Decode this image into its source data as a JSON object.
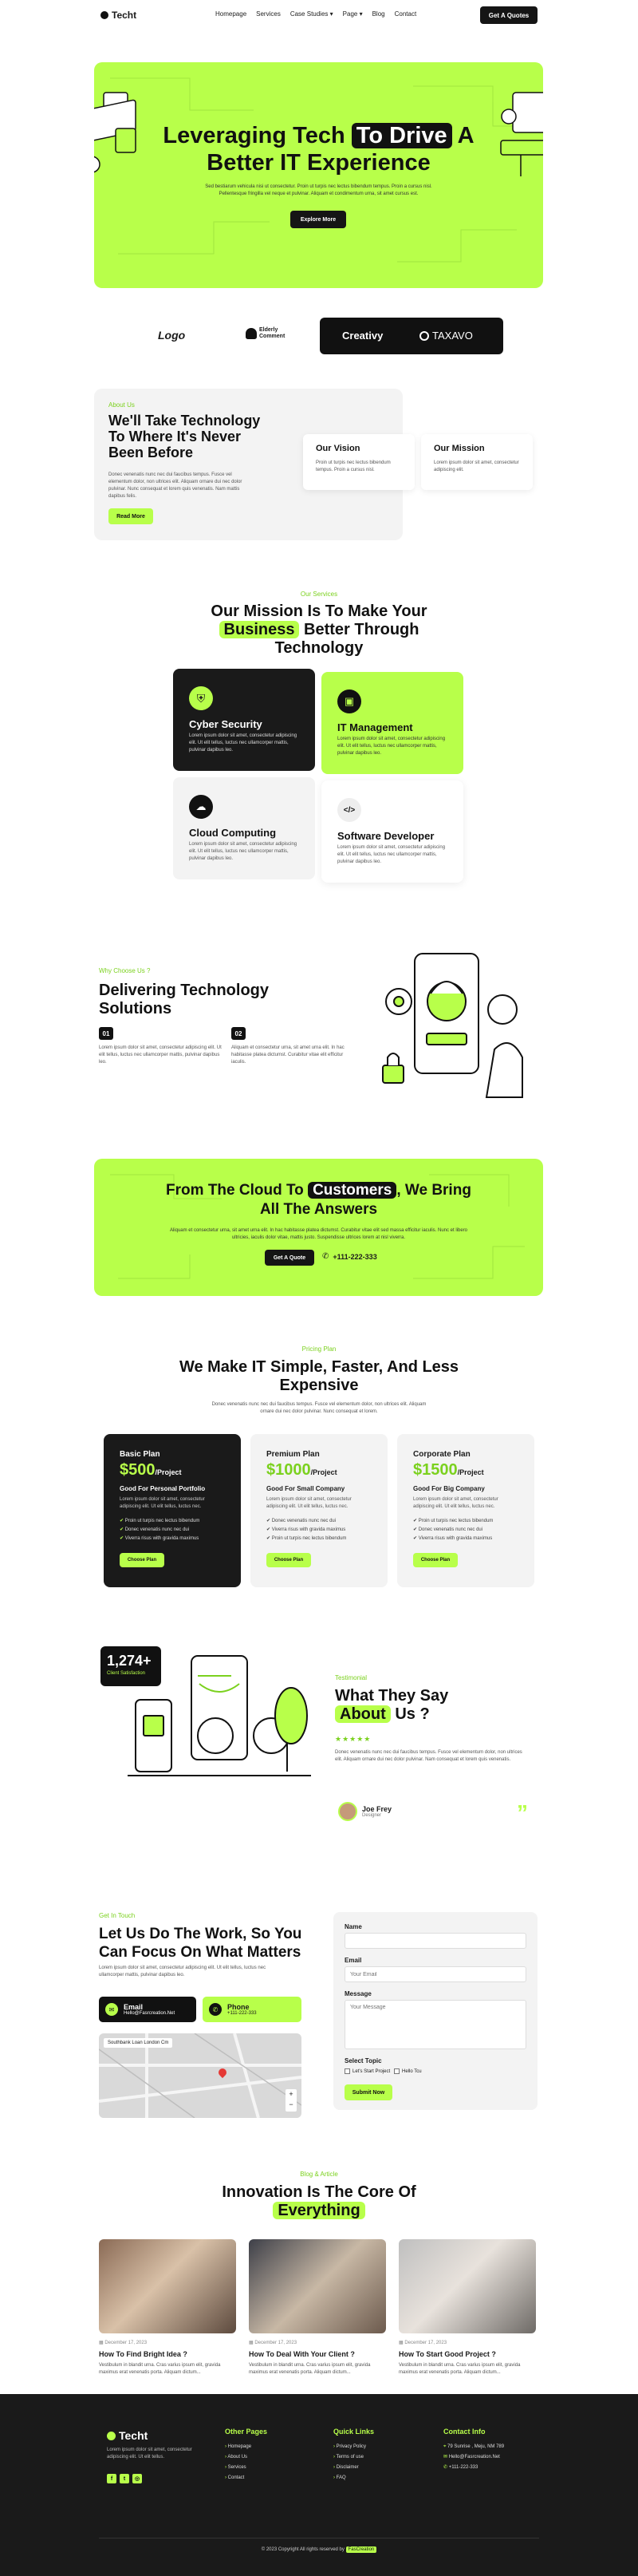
{
  "nav": {
    "logo": "Techt",
    "links": [
      "Homepage",
      "Services",
      "Case Studies ▾",
      "Page ▾",
      "Blog",
      "Contact"
    ],
    "cta": "Get A Quotes"
  },
  "hero": {
    "title_before": "Leveraging Tech",
    "title_highlight": "To Drive",
    "title_after": "A",
    "title_line2": "Better IT Experience",
    "text": "Sed bestiarum vehicula nisi ut consectetur. Proin ut turpis nec lectus bibendum tempus. Proin a cursus nisl. Pellentesque fringilla vel neque et pulvinar. Aliquam et condimentum urna, sit amet cursus est.",
    "button": "Explore More"
  },
  "logos": {
    "logo1": "Logo",
    "logo2_line1": "Elderly",
    "logo2_line2": "Comment",
    "logo3": "Creativy",
    "logo4": "TAXAVO"
  },
  "about": {
    "eyebrow": "About Us",
    "title_line1": "We'll Take Technology",
    "title_line2": "To Where It's Never",
    "title_line3": "Been Before",
    "text": "Donec venenatis nunc nec dui faucibus tempus. Fusce vel elementum dolor, non ultrices elit. Aliquam ornare dui nec dolor pulvinar. Nunc consequat et lorem quis venenatis. Nam mattis dapibus felis.",
    "button": "Read More",
    "vision_title": "Our Vision",
    "vision_text": "Proin ut turpis nec lectus bibendum tempus. Proin a cursus nisl.",
    "mission_title": "Our Mission",
    "mission_text": "Lorem ipsum dolor sit amet, consectetur adipiscing elit."
  },
  "services": {
    "eyebrow": "Our Services",
    "title_line1": "Our Mission Is To Make Your",
    "title_highlight": "Business",
    "title_line2_after": "Better Through",
    "title_line3": "Technology",
    "cards": [
      {
        "title": "Cyber Security",
        "text": "Lorem ipsum dolor sit amet, consectetur adipiscing elit. Ut elit tellus, luctus nec ullamcorper mattis, pulvinar dapibus leo."
      },
      {
        "title": "IT Management",
        "text": "Lorem ipsum dolor sit amet, consectetur adipiscing elit. Ut elit tellus, luctus nec ullamcorper mattis, pulvinar dapibus leo."
      },
      {
        "title": "Cloud Computing",
        "text": "Lorem ipsum dolor sit amet, consectetur adipiscing elit. Ut elit tellus, luctus nec ullamcorper mattis, pulvinar dapibus leo."
      },
      {
        "title": "Software Developer",
        "text": "Lorem ipsum dolor sit amet, consectetur adipiscing elit. Ut elit tellus, luctus nec ullamcorper mattis, pulvinar dapibus leo."
      }
    ]
  },
  "why": {
    "eyebrow": "Why Choose Us ?",
    "title_line1": "Delivering Technology",
    "title_line2": "Solutions",
    "item1_num": "01",
    "item1_text": "Lorem ipsum dolor sit amet, consectetur adipiscing elit. Ut elit tellus, luctus nec ullamcorper mattis, pulvinar dapibus leo.",
    "item2_num": "02",
    "item2_text": "Aliquam et consectetur urna, sit amet urna elit. In hac habitasse platea dictumst. Curabitur vitae elit efficitur iaculis."
  },
  "cta": {
    "title_before": "From The Cloud To",
    "title_highlight": "Customers",
    "title_after": ", We Bring",
    "title_line2": "All The Answers",
    "text": "Aliquam et consectetur urna, sit amet urna elit. In hac habitasse platea dictumst. Curabitur vitae elit sed massa efficitur iaculis. Nunc et libero ultricies, iaculis dolor vitae, mattis justo. Suspendisse ultrices lorem at nisl viverra.",
    "button": "Get A Quote",
    "phone": "+111-222-333"
  },
  "pricing": {
    "eyebrow": "Pricing Plan",
    "title_line1": "We Make IT Simple, Faster, And Less",
    "title_line2": "Expensive",
    "text": "Donec venenatis nunc nec dui faucibus tempus. Fusce vel elementum dolor, non ultrices elit. Aliquam ornare dui nec dolor pulvinar. Nunc consequat et lorem.",
    "plans": [
      {
        "name": "Basic Plan",
        "price": "$500",
        "unit": "/Project",
        "subtitle": "Good For Personal Portfolio",
        "text": "Lorem ipsum dolor sit amet, consectetur adipiscing elit. Ut elit tellus, luctus nec.",
        "features": [
          "Proin ut turpis nec lectus bibendum",
          "Donec venenatis nunc nec dui",
          "Viverra risus with gravida maximus"
        ],
        "button": "Choose Plan"
      },
      {
        "name": "Premium Plan",
        "price": "$1000",
        "unit": "/Project",
        "subtitle": "Good For Small Company",
        "text": "Lorem ipsum dolor sit amet, consectetur adipiscing elit. Ut elit tellus, luctus nec.",
        "features": [
          "Donec venenatis nunc nec dui",
          "Viverra risus with gravida maximus",
          "Proin ut turpis nec lectus bibendum"
        ],
        "button": "Choose Plan"
      },
      {
        "name": "Corporate Plan",
        "price": "$1500",
        "unit": "/Project",
        "subtitle": "Good For Big Company",
        "text": "Lorem ipsum dolor sit amet, consectetur adipiscing elit. Ut elit tellus, luctus nec.",
        "features": [
          "Proin ut turpis nec lectus bibendum",
          "Donec venenatis nunc nec dui",
          "Viverra risus with gravida maximus"
        ],
        "button": "Choose Plan"
      }
    ]
  },
  "testimonial": {
    "stat": "1,274+",
    "stat_label": "Client Satisfaction",
    "eyebrow": "Testimonial",
    "title_line1": "What They Say",
    "title_highlight": "About",
    "title_after": "Us ?",
    "stars": "★★★★★",
    "quote": "Donec venenatis nunc nec dui faucibus tempus. Fusce vel elementum dolor, non ultrices elit. Aliquam ornare dui nec dolor pulvinar. Nam consequat et lorem quis venenatis.",
    "name": "Joe Frey",
    "role": "Designer"
  },
  "contact": {
    "eyebrow": "Get In Touch",
    "title_line1": "Let Us Do The Work, So You",
    "title_line2": "Can Focus On What Matters",
    "text": "Lorem ipsum dolor sit amet, consectetur adipiscing elit. Ut elit tellus, luctus nec ullamcorper mattis, pulvinar dapibus leo.",
    "email_label": "Email",
    "email_value": "Hello@Fasrcreation.Net",
    "phone_label": "Phone",
    "phone_value": "+111-222-333",
    "map_label": "Southbank Loan London Cm",
    "form": {
      "name_label": "Name",
      "name_placeholder": "",
      "email_label": "Email",
      "email_placeholder": "Your Email",
      "message_label": "Message",
      "message_placeholder": "Your Message",
      "topic_label": "Select Topic",
      "topic1": "Let's Start Project",
      "topic2": "Hello Tcu",
      "submit": "Submit Now"
    }
  },
  "blog": {
    "eyebrow": "Blog & Article",
    "title_line1": "Innovation Is The Core Of",
    "title_highlight": "Everything",
    "posts": [
      {
        "date": "December 17, 2023",
        "title": "How To Find Bright Idea ?",
        "text": "Vestibulum in blandit urna. Cras varius ipsum elit, gravida maximus erat venenatis porta. Aliquam dictum..."
      },
      {
        "date": "December 17, 2023",
        "title": "How To Deal With Your Client ?",
        "text": "Vestibulum in blandit urna. Cras varius ipsum elit, gravida maximus erat venenatis porta. Aliquam dictum..."
      },
      {
        "date": "December 17, 2023",
        "title": "How To Start Good Project ?",
        "text": "Vestibulum in blandit urna. Cras varius ipsum elit, gravida maximus erat venenatis porta. Aliquam dictum..."
      }
    ]
  },
  "footer": {
    "logo": "Techt",
    "text": "Lorem ipsum dolor sit amet, consectetur adipiscing elit. Ut elit tellus.",
    "col1_title": "Other Pages",
    "col1": [
      "Homepage",
      "About Us",
      "Services",
      "Contact"
    ],
    "col2_title": "Quick Links",
    "col2": [
      "Privacy Policy",
      "Terms of use",
      "Disclaimer",
      "FAQ"
    ],
    "col3_title": "Contact Info",
    "col3": [
      "79 Sunrise , Meju, NM 789",
      "Hello@Fasrcreation.Net",
      "+111-222-333"
    ],
    "copyright": "© 2023 Copyright All rights reserved by",
    "brand": "FasCreation"
  },
  "colors": {
    "accent": "#b8ff4a",
    "dark": "#151515",
    "light_panel": "#f3f3f3"
  }
}
